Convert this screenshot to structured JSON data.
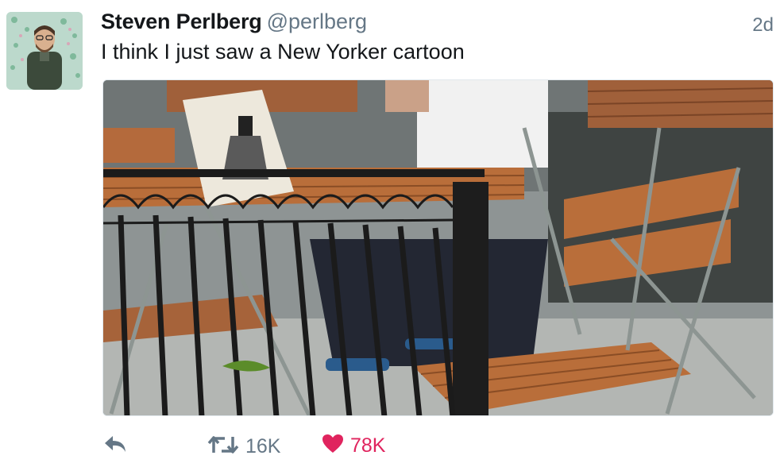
{
  "tweet": {
    "author_name": "Steven Perlberg",
    "author_handle": "@perlberg",
    "timestamp": "2d",
    "text": "I think I just saw a New Yorker cartoon"
  },
  "actions": {
    "reply_icon": "reply-icon",
    "retweet_icon": "retweet-icon",
    "retweet_count": "16K",
    "like_icon": "heart-icon",
    "like_count": "78K"
  },
  "colors": {
    "text": "#14171a",
    "muted": "#657786",
    "like": "#e0245e"
  }
}
